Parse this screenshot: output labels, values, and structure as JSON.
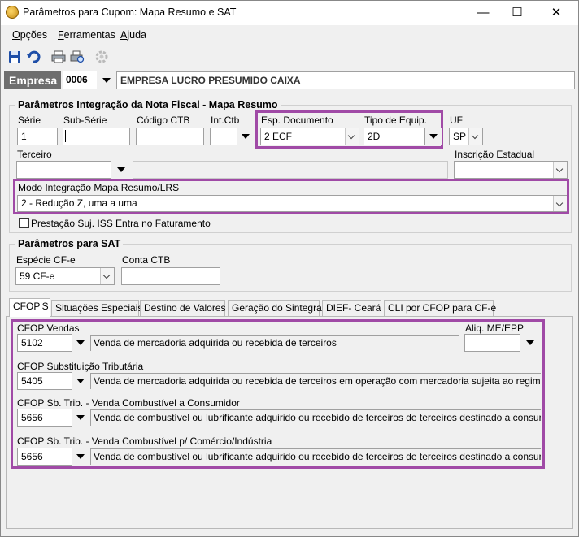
{
  "window": {
    "title": "Parâmetros para Cupom: Mapa Resumo e SAT",
    "minimize": "—",
    "maximize": "☐",
    "close": "✕"
  },
  "menu": [
    {
      "label": "Opções",
      "accel": "O",
      "rest": "pções"
    },
    {
      "label": "Ferramentas",
      "accel": "F",
      "rest": "erramentas"
    },
    {
      "label": "Ajuda",
      "accel": "A",
      "rest": "juda"
    }
  ],
  "toolbar": {
    "icons": [
      "save-icon",
      "undo-icon",
      "print-icon",
      "print-preview-icon",
      "settings-gear-icon"
    ]
  },
  "empresa": {
    "label": "Empresa",
    "code": "0006",
    "name": "EMPRESA LUCRO PRESUMIDO CAIXA"
  },
  "mapa_resumo": {
    "title": "Parâmetros Integração da Nota Fiscal - Mapa Resumo",
    "serie": {
      "label": "Série",
      "value": "1"
    },
    "sub_serie": {
      "label": "Sub-Série",
      "value": ""
    },
    "codigo_ctb": {
      "label": "Código CTB",
      "value": ""
    },
    "int_ctb": {
      "label": "Int.Ctb",
      "value": ""
    },
    "esp_documento": {
      "label": "Esp. Documento",
      "value": "2 ECF"
    },
    "tipo_equip": {
      "label": "Tipo de Equip.",
      "value": "2D"
    },
    "uf": {
      "label": "UF",
      "value": "SP"
    },
    "terceiro": {
      "label": "Terceiro",
      "value": ""
    },
    "inscricao_estadual": {
      "label": "Inscrição Estadual",
      "value": ""
    },
    "modo_integracao": {
      "label": "Modo Integração Mapa Resumo/LRS",
      "value": "2 - Redução Z, uma a uma"
    },
    "prestacao_iss": {
      "label": "Prestação Suj. ISS Entra no Faturamento",
      "checked": false
    }
  },
  "sat": {
    "title": "Parâmetros para SAT",
    "especie_cfe": {
      "label": "Espécie CF-e",
      "value": "59 CF-e"
    },
    "conta_ctb": {
      "label": "Conta CTB",
      "value": ""
    }
  },
  "tabs": [
    {
      "label": "CFOP'S",
      "active": true
    },
    {
      "label": "Situações Especiais",
      "active": false
    },
    {
      "label": "Destino de Valores",
      "active": false
    },
    {
      "label": "Geração do Sintegra",
      "active": false
    },
    {
      "label": "DIEF- Ceará",
      "active": false
    },
    {
      "label": "CLI por CFOP para CF-e",
      "active": false
    }
  ],
  "cfops": {
    "vendas": {
      "label": "CFOP Vendas",
      "code": "5102",
      "desc": "Venda de mercadoria adquirida ou recebida de terceiros"
    },
    "aliq_me_epp": {
      "label": "Aliq. ME/EPP",
      "value": ""
    },
    "subst_trib": {
      "label": "CFOP Substituição Tributária",
      "code": "5405",
      "desc": "Venda de mercadoria adquirida ou recebida de terceiros em operação com mercadoria sujeita ao regime de s"
    },
    "comb_consumidor": {
      "label": "CFOP Sb. Trib. - Venda Combustível a Consumidor",
      "code": "5656",
      "desc": "Venda de combustível ou lubrificante adquirido ou recebido de terceiros de terceiros destinado a consumidor"
    },
    "comb_comercio": {
      "label": "CFOP Sb. Trib. - Venda Combustível p/ Comércio/Indústria",
      "code": "5656",
      "desc": "Venda de combustível ou lubrificante adquirido ou recebido de terceiros de terceiros destinado a consumidor"
    }
  },
  "colors": {
    "highlight": "#a04aa6",
    "empresa_label_bg": "#6e6e6e"
  }
}
